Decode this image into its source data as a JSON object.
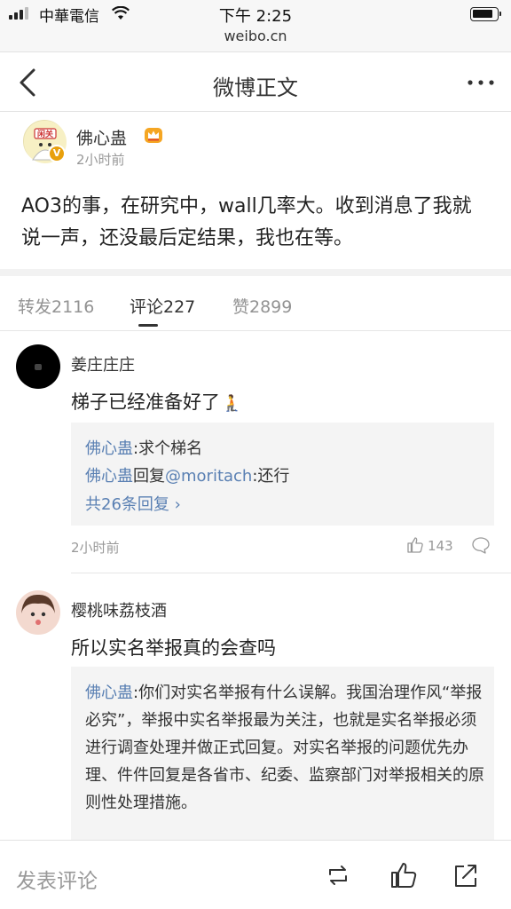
{
  "status_bar": {
    "carrier": "中華電信",
    "time": "下午 2:25"
  },
  "browser": {
    "url": "weibo.cn"
  },
  "nav": {
    "title": "微博正文"
  },
  "post": {
    "author": "佛心蛊",
    "time": "2小时前",
    "verified_mark": "V",
    "avatar_text": "闲关",
    "text": "AO3的事，在研究中，wall几率大。收到消息了我就说一声，还没最后定结果，我也在等。"
  },
  "tabs": [
    {
      "label": "转发2116"
    },
    {
      "label": "评论227"
    },
    {
      "label": "赞2899"
    }
  ],
  "comments": [
    {
      "name": "姜庄庄庄",
      "text": "梯子已经准备好了",
      "emoji": "🧎",
      "replies": [
        {
          "user": "佛心蛊",
          "sep": ":",
          "text": "求个梯名"
        },
        {
          "user": "佛心蛊",
          "verb": "回复",
          "mention": "@moritach",
          "sep": ":",
          "text": "还行"
        }
      ],
      "more": "共26条回复 ›",
      "time": "2小时前",
      "likes": "143"
    },
    {
      "name": "樱桃味荔枝酒",
      "text": "所以实名举报真的会查吗",
      "reply": {
        "user": "佛心蛊",
        "text": ":你们对实名举报有什么误解。我国治理作风“举报必究”，举报中实名举报最为关注，也就是实名举报必须进行调查处理并做正式回复。对实名举报的问题优先办理、件件回复是各省市、纪委、监察部门对举报相关的原则性处理措施。"
      }
    }
  ],
  "bottom": {
    "compose_placeholder": "发表评论"
  },
  "colors": {
    "link": "#5a80b3",
    "verified": "#e8a00c",
    "muted": "#999999"
  },
  "icons": [
    "back-icon",
    "more-icon",
    "crown-icon",
    "like-icon",
    "comment-icon",
    "repost-icon",
    "share-icon"
  ]
}
